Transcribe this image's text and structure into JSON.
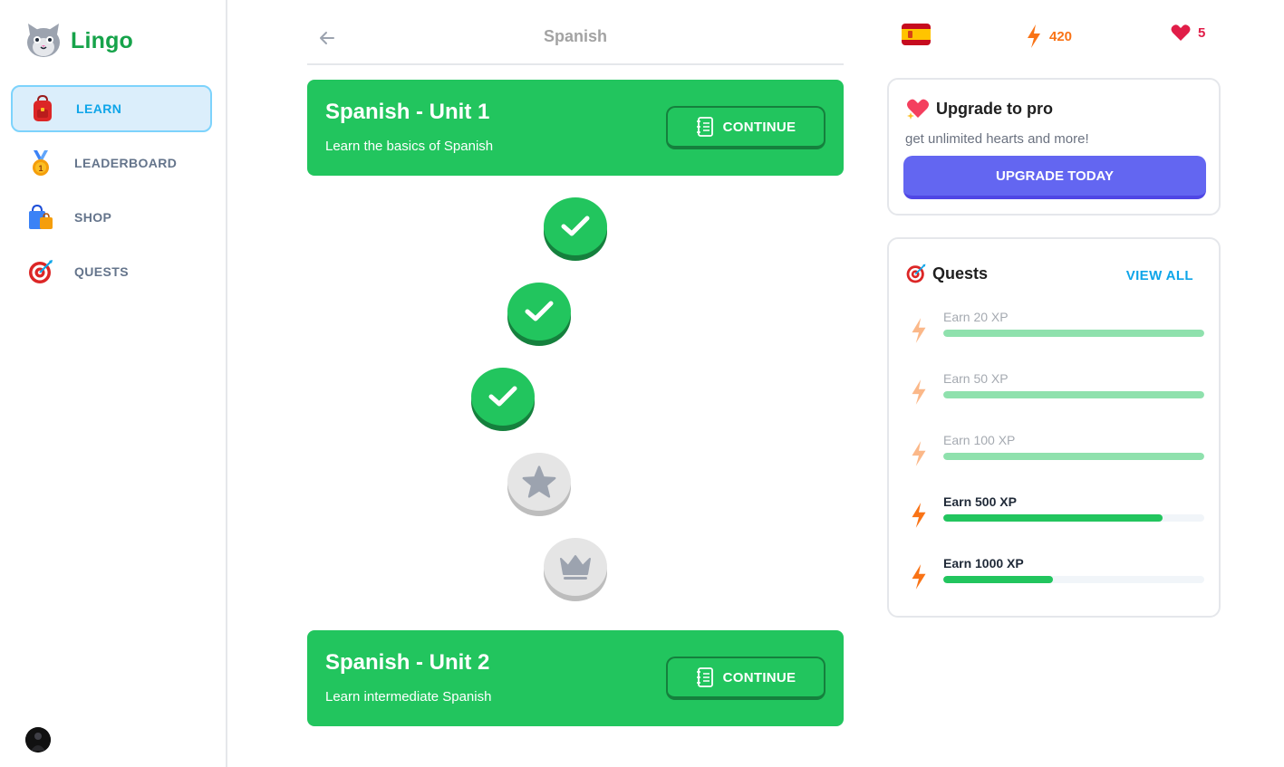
{
  "app": {
    "name": "Lingo"
  },
  "sidebar": {
    "items": [
      {
        "label": "LEARN",
        "icon": "backpack-icon",
        "active": true
      },
      {
        "label": "LEADERBOARD",
        "icon": "medal-icon",
        "active": false
      },
      {
        "label": "SHOP",
        "icon": "shopping-bag-icon",
        "active": false
      },
      {
        "label": "QUESTS",
        "icon": "target-icon",
        "active": false
      }
    ]
  },
  "header": {
    "title": "Spanish"
  },
  "units": [
    {
      "title": "Spanish - Unit 1",
      "description": "Learn the basics of Spanish",
      "button_label": "CONTINUE"
    },
    {
      "title": "Spanish - Unit 2",
      "description": "Learn intermediate Spanish",
      "button_label": "CONTINUE"
    }
  ],
  "lessons": [
    {
      "state": "completed",
      "icon": "check-icon"
    },
    {
      "state": "completed",
      "icon": "check-icon"
    },
    {
      "state": "completed",
      "icon": "check-icon"
    },
    {
      "state": "locked",
      "icon": "star-icon"
    },
    {
      "state": "locked",
      "icon": "crown-icon"
    }
  ],
  "stats": {
    "language_flag": "spain-flag-icon",
    "xp": "420",
    "hearts": "5"
  },
  "pro_card": {
    "title": "Upgrade to pro",
    "subtitle": "get unlimited hearts and more!",
    "button_label": "UPGRADE TODAY"
  },
  "quests": {
    "title": "Quests",
    "view_all_label": "VIEW ALL",
    "items": [
      {
        "label": "Earn 20 XP",
        "progress": 1.0
      },
      {
        "label": "Earn 50 XP",
        "progress": 1.0
      },
      {
        "label": "Earn 100 XP",
        "progress": 1.0
      },
      {
        "label": "Earn 500 XP",
        "progress": 0.84
      },
      {
        "label": "Earn 1000 XP",
        "progress": 0.42
      }
    ]
  },
  "colors": {
    "brand_green": "#22c55e",
    "accent_blue": "#0ea5e9",
    "upgrade_purple": "#6366f1",
    "xp_orange": "#f97316",
    "heart_red": "#e11d48"
  }
}
